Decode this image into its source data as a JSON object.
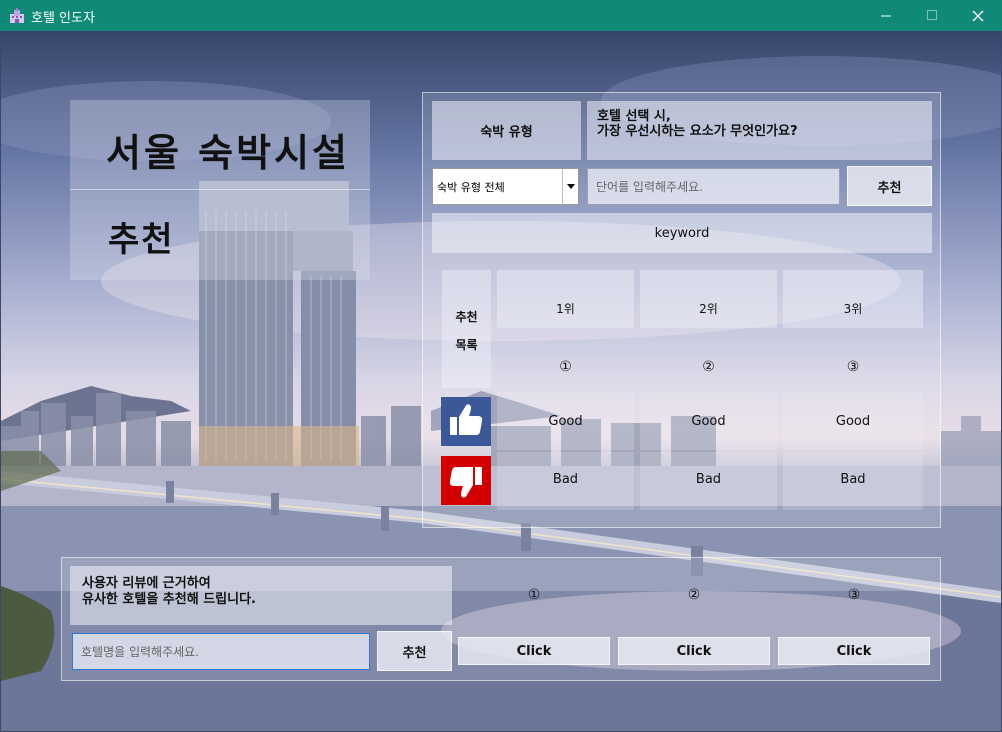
{
  "window": {
    "title": "호텔 인도자"
  },
  "header": {
    "line1": "서울 숙박시설",
    "line2": "추천"
  },
  "keyword_search": {
    "type_label": "숙박 유형",
    "question": "호텔 선택 시,\n가장 우선시하는 요소가 무엇인가요?",
    "select_value": "숙박 유형 전체",
    "input_placeholder": "단어를 입력해주세요.",
    "button_label": "추천",
    "keyword_label": "keyword"
  },
  "results": {
    "list_label_1": "추천",
    "list_label_2": "목록",
    "ranks": [
      "1위",
      "2위",
      "3위"
    ],
    "numbers": [
      "①",
      "②",
      "③"
    ],
    "good": [
      "Good",
      "Good",
      "Good"
    ],
    "bad": [
      "Bad",
      "Bad",
      "Bad"
    ]
  },
  "review_search": {
    "description": "사용자 리뷰에 근거하여\n유사한 호텔을 추천해 드립니다.",
    "input_placeholder": "호텔명을 입력해주세요.",
    "button_label": "추천",
    "numbers": [
      "①",
      "②",
      "③"
    ],
    "click_labels": [
      "Click",
      "Click",
      "Click"
    ]
  },
  "colors": {
    "titlebar": "#0f8a76",
    "thumbs_up_bg": "#3b5998",
    "thumbs_down_bg": "#d40000"
  },
  "icons": {
    "app": "app-icon",
    "like": "thumbs-up-icon",
    "dislike": "thumbs-down-icon"
  }
}
